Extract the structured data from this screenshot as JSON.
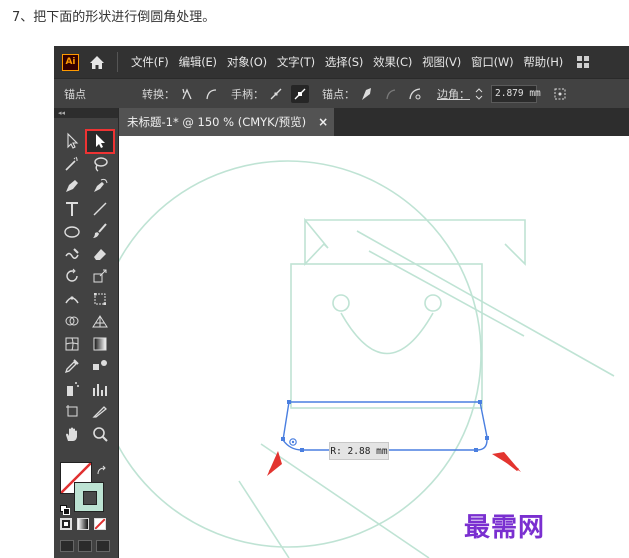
{
  "instruction": "7、把下面的形状进行倒圆角处理。",
  "app": {
    "logo_text": "Ai",
    "menu": [
      "文件(F)",
      "编辑(E)",
      "对象(O)",
      "文字(T)",
      "选择(S)",
      "效果(C)",
      "视图(V)",
      "窗口(W)",
      "帮助(H)"
    ]
  },
  "control_bar": {
    "anchor_label": "锚点",
    "convert_label": "转换：",
    "handles_label": "手柄：",
    "anchors_label": "锚点：",
    "corner_label": "边角：",
    "corner_value": "2.879 mm"
  },
  "document": {
    "tab_title": "未标题-1* @ 150 % (CMYK/预览)",
    "close_glyph": "×"
  },
  "canvas": {
    "radius_tooltip": "R: 2.88 mm",
    "shape_stroke": "#bfe3d4",
    "selection_color": "#4a7fe0",
    "arrow_color": "#e3342f"
  },
  "toolbar": {
    "tools": [
      "selection-tool-icon",
      "direct-selection-tool-icon",
      "magic-wand-tool-icon",
      "lasso-tool-icon",
      "pen-tool-icon",
      "curvature-tool-icon",
      "type-tool-icon",
      "line-segment-tool-icon",
      "ellipse-tool-icon",
      "paintbrush-tool-icon",
      "shaper-tool-icon",
      "eraser-tool-icon",
      "rotate-tool-icon",
      "scale-tool-icon",
      "width-tool-icon",
      "free-transform-tool-icon",
      "shape-builder-tool-icon",
      "perspective-grid-tool-icon",
      "mesh-tool-icon",
      "gradient-tool-icon",
      "eyedropper-tool-icon",
      "blend-tool-icon",
      "symbol-sprayer-tool-icon",
      "column-graph-tool-icon",
      "artboard-tool-icon",
      "slice-tool-icon",
      "hand-tool-icon",
      "zoom-tool-icon"
    ],
    "selected_tool": "direct-selection-tool-icon"
  },
  "watermark": "最需网"
}
